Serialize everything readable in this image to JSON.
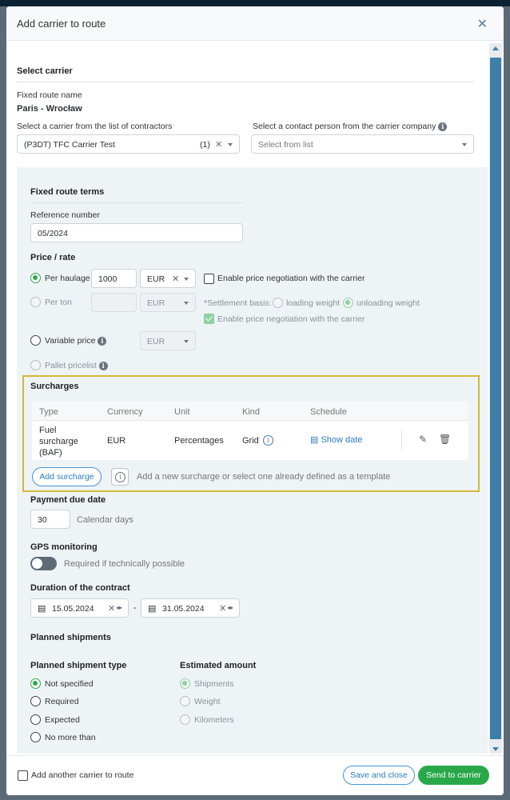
{
  "modal": {
    "title": "Add carrier to route"
  },
  "select_carrier": {
    "heading": "Select carrier",
    "fixed_route_label": "Fixed route name",
    "fixed_route_value": "Paris - Wrocław",
    "carrier_label": "Select a carrier from the list of contractors",
    "carrier_value": "(P3DT) TFC Carrier Test",
    "carrier_count": "(1)",
    "contact_label": "Select a contact person from the carrier company",
    "contact_placeholder": "Select from list"
  },
  "terms": {
    "heading": "Fixed route terms",
    "reference_label": "Reference number",
    "reference_value": "05/2024",
    "price_heading": "Price / rate",
    "per_haulage_label": "Per haulage",
    "per_haulage_value": "1000",
    "currency": "EUR",
    "enable_negotiation": "Enable price negotiation with the carrier",
    "per_ton_label": "Per ton",
    "settlement_basis": "*Settlement basis:",
    "loading_weight": "loading weight",
    "unloading_weight": "unloading weight",
    "variable_price_label": "Variable price",
    "pallet_pricelist_label": "Pallet pricelist"
  },
  "surcharges": {
    "heading": "Surcharges",
    "columns": [
      "Type",
      "Currency",
      "Unit",
      "Kind",
      "Schedule"
    ],
    "rows": [
      {
        "type_line1": "Fuel",
        "type_line2": "surcharge",
        "type_line3": "(BAF)",
        "currency": "EUR",
        "unit": "Percentages",
        "kind": "Grid",
        "schedule": "Show date"
      }
    ],
    "add_button": "Add surcharge",
    "hint": "Add a new surcharge or select one already defined as a template"
  },
  "payment": {
    "heading": "Payment due date",
    "value": "30",
    "unit": "Calendar days"
  },
  "gps": {
    "heading": "GPS monitoring",
    "toggle_label": "Required if technically possible"
  },
  "duration": {
    "heading": "Duration of the contract",
    "from": "15.05.2024",
    "separator": "-",
    "to": "31.05.2024"
  },
  "planned": {
    "heading": "Planned shipments",
    "type_heading": "Planned shipment type",
    "types": [
      "Not specified",
      "Required",
      "Expected",
      "No more than"
    ],
    "amount_heading": "Estimated amount",
    "amounts": [
      "Shipments",
      "Weight",
      "Kilometers"
    ]
  },
  "footer": {
    "add_another": "Add another carrier to route",
    "save_close": "Save and close",
    "send": "Send to carrier"
  },
  "colors": {
    "accent_green": "#29a84a",
    "link_blue": "#2a7cc3",
    "highlight_yellow": "#d6b63a"
  }
}
